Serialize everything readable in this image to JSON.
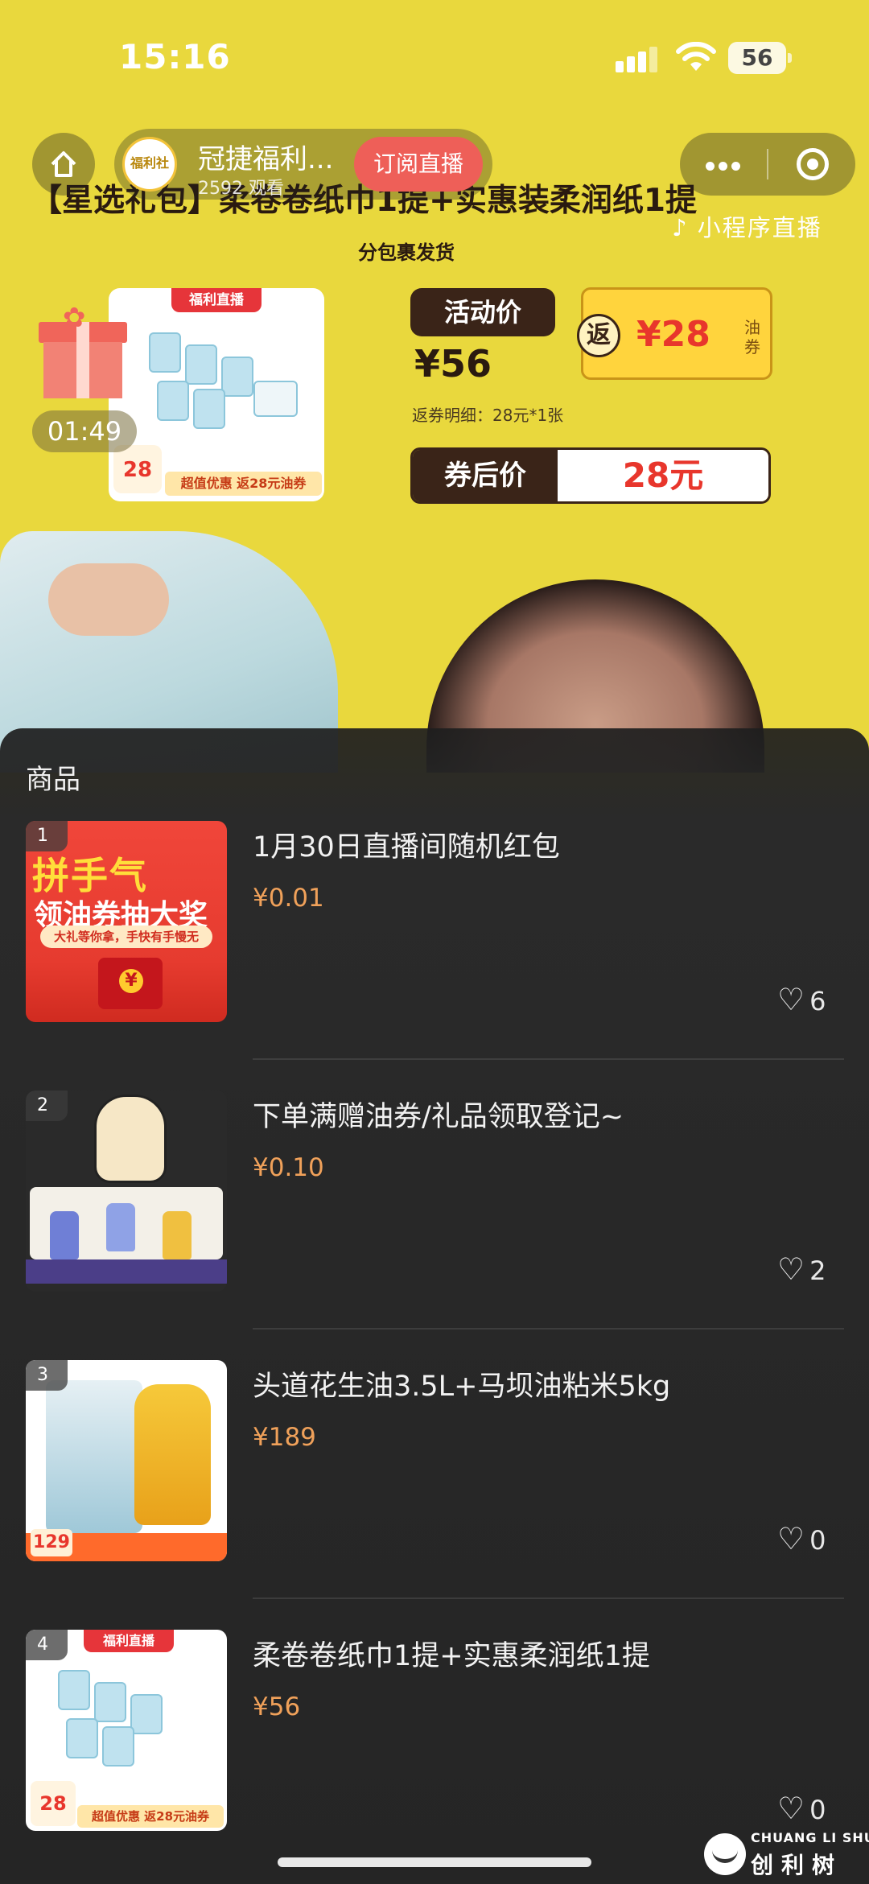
{
  "status_bar": {
    "time": "15:16",
    "battery": "56"
  },
  "host": {
    "name": "冠捷福利...",
    "avatar_label": "福利社",
    "views": "2592 观看"
  },
  "subscribe_label": "订阅直播",
  "mini_program_label": "小程序直播",
  "banner": {
    "title": "【星选礼包】柔卷卷纸巾1提+实惠装柔润纸1提",
    "subtitle": "分包裹发货",
    "activity_label": "活动价",
    "activity_price": "¥56",
    "coupon_return": "返",
    "coupon_amount": "¥28",
    "coupon_unit": "油券",
    "coupon_detail": "返券明细：28元*1张",
    "after_coupon_label": "券后价",
    "after_coupon_value": "28元",
    "card_tag": "福利直播",
    "card_price": "28",
    "card_bottom": "超值优惠 返28元油券"
  },
  "timer": "01:49",
  "panel": {
    "title": "商品",
    "items": [
      {
        "index": "1",
        "name": "1月30日直播间随机红包",
        "price": "¥0.01",
        "likes": "6",
        "thumb_big": "拼手气",
        "thumb_mid": "领油券抽大奖",
        "thumb_pill": "大礼等你拿，手快有手慢无"
      },
      {
        "index": "2",
        "name": "下单满赠油券/礼品领取登记~",
        "price": "¥0.10",
        "likes": "2"
      },
      {
        "index": "3",
        "name": "头道花生油3.5L+马坝油粘米5kg",
        "price": "¥189",
        "likes": "0",
        "thumb_price": "129"
      },
      {
        "index": "4",
        "name": "柔卷卷纸巾1提+实惠柔润纸1提",
        "price": "¥56",
        "likes": "0",
        "thumb_tag": "福利直播",
        "thumb_price": "28",
        "thumb_bottom": "超值优惠 返28元油券"
      }
    ]
  },
  "watermark": {
    "en": "CHUANG LI SHU",
    "cn": "创利树"
  }
}
